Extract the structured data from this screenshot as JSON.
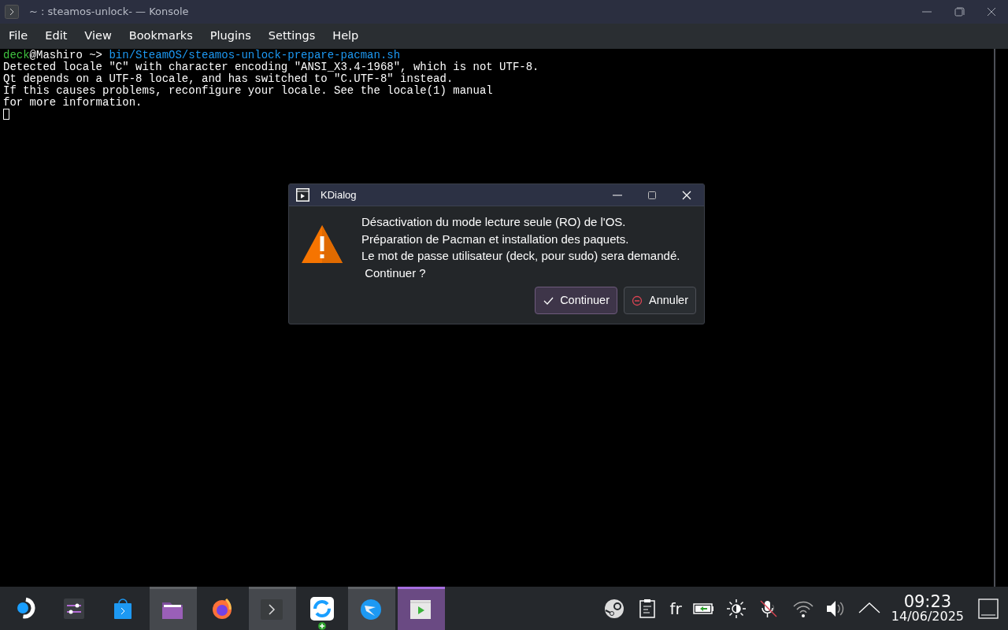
{
  "window": {
    "title": "~ : steamos-unlock- — Konsole"
  },
  "menu": [
    "File",
    "Edit",
    "View",
    "Bookmarks",
    "Plugins",
    "Settings",
    "Help"
  ],
  "terminal": {
    "lines": [
      [
        {
          "kind": "user",
          "text": "deck"
        },
        {
          "kind": "plain",
          "text": "@Mashiro ~> "
        },
        {
          "kind": "command",
          "text": "bin/SteamOS/steamos-unlock-prepare-pacman.sh"
        }
      ],
      [
        {
          "kind": "plain",
          "text": "Detected locale \"C\" with character encoding \"ANSI_X3.4-1968\", which is not UTF-8."
        }
      ],
      [
        {
          "kind": "plain",
          "text": "Qt depends on a UTF-8 locale, and has switched to \"C.UTF-8\" instead."
        }
      ],
      [
        {
          "kind": "plain",
          "text": "If this causes problems, reconfigure your locale. See the locale(1) manual"
        }
      ],
      [
        {
          "kind": "plain",
          "text": "for more information."
        }
      ]
    ]
  },
  "dialog": {
    "title": "KDialog",
    "message": [
      "Désactivation du mode lecture seule (RO) de l'OS.",
      "Préparation de Pacman et installation des paquets.",
      "Le mot de passe utilisateur (deck, pour sudo) sera demandé.",
      " Continuer ?"
    ],
    "buttons": [
      {
        "label": "Continuer",
        "kind": "confirm",
        "default": true
      },
      {
        "label": "Annuler",
        "kind": "cancel",
        "default": false
      }
    ]
  },
  "taskbar": {
    "apps": [
      {
        "kind": "launcher",
        "open": false,
        "selected": false
      },
      {
        "kind": "mixer",
        "open": false,
        "selected": false
      },
      {
        "kind": "store",
        "open": false,
        "selected": false
      },
      {
        "kind": "folder",
        "open": true,
        "selected": false
      },
      {
        "kind": "browser",
        "open": false,
        "selected": false
      },
      {
        "kind": "terminal",
        "open": true,
        "selected": false
      },
      {
        "kind": "sync",
        "open": false,
        "selected": false
      },
      {
        "kind": "bird",
        "open": true,
        "selected": false
      },
      {
        "kind": "player",
        "open": true,
        "selected": true
      }
    ],
    "tray": [
      {
        "kind": "steam"
      },
      {
        "kind": "clipboard"
      },
      {
        "kind": "text",
        "text": "fr"
      },
      {
        "kind": "battery"
      },
      {
        "kind": "brightness"
      },
      {
        "kind": "mic-muted"
      },
      {
        "kind": "wifi"
      },
      {
        "kind": "volume"
      },
      {
        "kind": "expand"
      }
    ],
    "time": "09:23",
    "date": "14/06/2025"
  }
}
